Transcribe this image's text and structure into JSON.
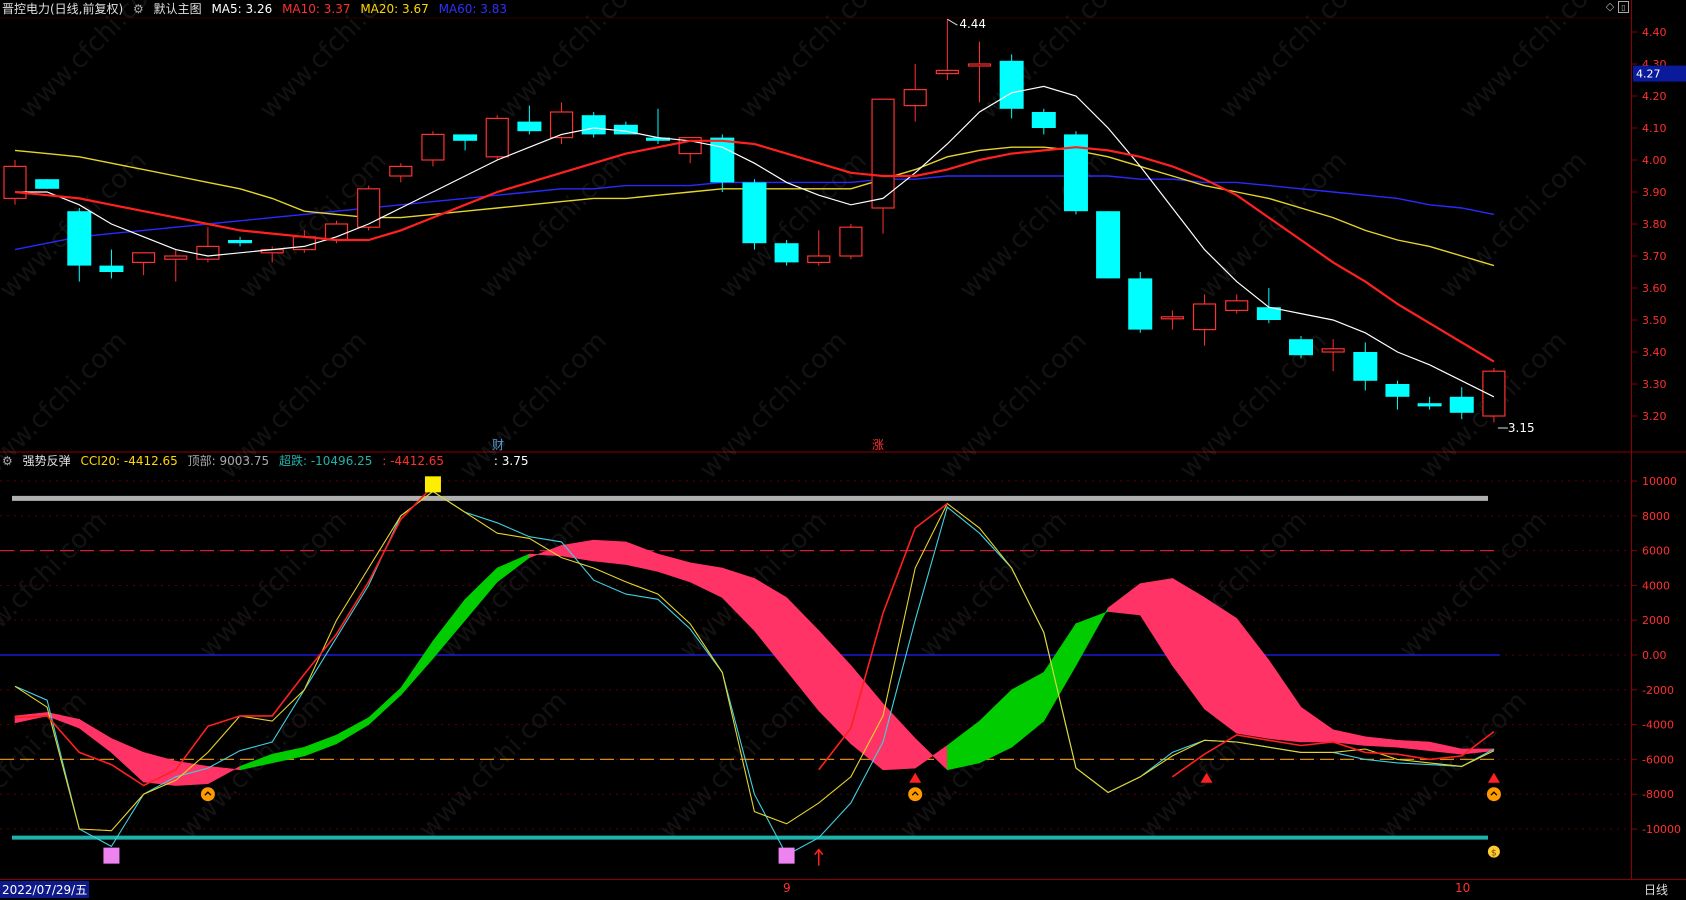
{
  "top_panel": {
    "title": "晋控电力(日线,前复权)",
    "main_chart_label": "默认主图",
    "ma_labels": [
      {
        "text": "MA5: 3.26",
        "color": "#ffffff"
      },
      {
        "text": "MA10: 3.37",
        "color": "#ff3030"
      },
      {
        "text": "MA20: 3.67",
        "color": "#ffd700"
      },
      {
        "text": "MA60: 3.83",
        "color": "#3030ff"
      }
    ],
    "current_price_tag": "4.27",
    "high_label": "4.44",
    "low_label": "3.15",
    "markers": [
      {
        "text": "财",
        "color": "#5a9bd5"
      },
      {
        "text": "涨",
        "color": "#ff3030"
      }
    ]
  },
  "bottom_panel": {
    "indicator_name": "强势反弹",
    "cci_label": "CCI20: -4412.65",
    "top_label": "顶部: 9003.75",
    "oversold_label": "超跌: -10496.25",
    "extra_label": ": -4412.65",
    "extra_label2": ": 3.75"
  },
  "bottom_bar": {
    "date": "2022/07/29/五",
    "period": "日线",
    "tick_9": "9",
    "tick_10": "10"
  },
  "watermark": "www.cfchi.com",
  "colors": {
    "up": "#ff3030",
    "down": "#00ffff",
    "ma5": "#ffffff",
    "ma10": "#ff2020",
    "ma20": "#e6d42a",
    "ma60": "#2a2aff",
    "pink": "#ff3366",
    "green": "#00cc00"
  },
  "chart_data": [
    {
      "type": "candlestick",
      "title": "晋控电力(日线,前复权)",
      "ylim": [
        3.15,
        4.44
      ],
      "yticks": [
        "4.40",
        "4.30",
        "4.20",
        "4.10",
        "4.00",
        "3.90",
        "3.80",
        "3.70",
        "3.60",
        "3.50",
        "3.40",
        "3.30",
        "3.20"
      ],
      "candles": [
        {
          "o": 3.88,
          "h": 4.0,
          "l": 3.86,
          "c": 3.98
        },
        {
          "o": 3.94,
          "h": 3.94,
          "l": 3.91,
          "c": 3.91
        },
        {
          "o": 3.84,
          "h": 3.85,
          "l": 3.62,
          "c": 3.67
        },
        {
          "o": 3.67,
          "h": 3.72,
          "l": 3.63,
          "c": 3.65
        },
        {
          "o": 3.68,
          "h": 3.71,
          "l": 3.64,
          "c": 3.71
        },
        {
          "o": 3.69,
          "h": 3.72,
          "l": 3.62,
          "c": 3.7
        },
        {
          "o": 3.69,
          "h": 3.79,
          "l": 3.68,
          "c": 3.73
        },
        {
          "o": 3.75,
          "h": 3.76,
          "l": 3.73,
          "c": 3.74
        },
        {
          "o": 3.71,
          "h": 3.73,
          "l": 3.68,
          "c": 3.72
        },
        {
          "o": 3.72,
          "h": 3.78,
          "l": 3.71,
          "c": 3.76
        },
        {
          "o": 3.75,
          "h": 3.81,
          "l": 3.74,
          "c": 3.8
        },
        {
          "o": 3.79,
          "h": 3.92,
          "l": 3.78,
          "c": 3.91
        },
        {
          "o": 3.95,
          "h": 3.99,
          "l": 3.93,
          "c": 3.98
        },
        {
          "o": 4.0,
          "h": 4.09,
          "l": 3.98,
          "c": 4.08
        },
        {
          "o": 4.08,
          "h": 4.08,
          "l": 4.03,
          "c": 4.06
        },
        {
          "o": 4.01,
          "h": 4.14,
          "l": 4.0,
          "c": 4.13
        },
        {
          "o": 4.12,
          "h": 4.17,
          "l": 4.08,
          "c": 4.09
        },
        {
          "o": 4.07,
          "h": 4.18,
          "l": 4.05,
          "c": 4.15
        },
        {
          "o": 4.14,
          "h": 4.15,
          "l": 4.07,
          "c": 4.08
        },
        {
          "o": 4.11,
          "h": 4.12,
          "l": 4.08,
          "c": 4.08
        },
        {
          "o": 4.07,
          "h": 4.16,
          "l": 4.05,
          "c": 4.06
        },
        {
          "o": 4.02,
          "h": 4.07,
          "l": 3.99,
          "c": 4.07
        },
        {
          "o": 4.07,
          "h": 4.08,
          "l": 3.9,
          "c": 3.93
        },
        {
          "o": 3.93,
          "h": 3.94,
          "l": 3.72,
          "c": 3.74
        },
        {
          "o": 3.74,
          "h": 3.75,
          "l": 3.67,
          "c": 3.68
        },
        {
          "o": 3.68,
          "h": 3.78,
          "l": 3.67,
          "c": 3.7
        },
        {
          "o": 3.7,
          "h": 3.8,
          "l": 3.69,
          "c": 3.79
        },
        {
          "o": 3.85,
          "h": 4.19,
          "l": 3.77,
          "c": 4.19
        },
        {
          "o": 4.17,
          "h": 4.3,
          "l": 4.12,
          "c": 4.22
        },
        {
          "o": 4.27,
          "h": 4.44,
          "l": 4.25,
          "c": 4.28
        },
        {
          "o": 4.3,
          "h": 4.37,
          "l": 4.18,
          "c": 4.3
        },
        {
          "o": 4.31,
          "h": 4.33,
          "l": 4.13,
          "c": 4.16
        },
        {
          "o": 4.15,
          "h": 4.16,
          "l": 4.08,
          "c": 4.1
        },
        {
          "o": 4.08,
          "h": 4.09,
          "l": 3.83,
          "c": 3.84
        },
        {
          "o": 3.84,
          "h": 3.84,
          "l": 3.63,
          "c": 3.63
        },
        {
          "o": 3.63,
          "h": 3.65,
          "l": 3.46,
          "c": 3.47
        },
        {
          "o": 3.51,
          "h": 3.53,
          "l": 3.47,
          "c": 3.51
        },
        {
          "o": 3.47,
          "h": 3.58,
          "l": 3.42,
          "c": 3.55
        },
        {
          "o": 3.53,
          "h": 3.58,
          "l": 3.52,
          "c": 3.56
        },
        {
          "o": 3.54,
          "h": 3.6,
          "l": 3.49,
          "c": 3.5
        },
        {
          "o": 3.44,
          "h": 3.45,
          "l": 3.38,
          "c": 3.39
        },
        {
          "o": 3.4,
          "h": 3.44,
          "l": 3.34,
          "c": 3.41
        },
        {
          "o": 3.4,
          "h": 3.43,
          "l": 3.28,
          "c": 3.31
        },
        {
          "o": 3.3,
          "h": 3.31,
          "l": 3.22,
          "c": 3.26
        },
        {
          "o": 3.24,
          "h": 3.26,
          "l": 3.22,
          "c": 3.23
        },
        {
          "o": 3.26,
          "h": 3.29,
          "l": 3.19,
          "c": 3.21
        },
        {
          "o": 3.2,
          "h": 3.35,
          "l": 3.18,
          "c": 3.34
        }
      ],
      "ma5": [
        3.9,
        3.9,
        3.86,
        3.8,
        3.76,
        3.72,
        3.7,
        3.71,
        3.72,
        3.73,
        3.76,
        3.8,
        3.85,
        3.9,
        3.95,
        4.0,
        4.04,
        4.08,
        4.1,
        4.09,
        4.07,
        4.06,
        4.04,
        3.99,
        3.93,
        3.89,
        3.86,
        3.88,
        3.96,
        4.05,
        4.15,
        4.21,
        4.23,
        4.2,
        4.1,
        3.98,
        3.85,
        3.72,
        3.62,
        3.54,
        3.52,
        3.5,
        3.46,
        3.4,
        3.36,
        3.31,
        3.26
      ],
      "ma10": [
        3.9,
        3.89,
        3.88,
        3.86,
        3.84,
        3.82,
        3.8,
        3.78,
        3.77,
        3.76,
        3.75,
        3.75,
        3.78,
        3.82,
        3.86,
        3.9,
        3.93,
        3.96,
        3.99,
        4.02,
        4.04,
        4.06,
        4.06,
        4.05,
        4.02,
        3.99,
        3.96,
        3.95,
        3.95,
        3.97,
        4.0,
        4.02,
        4.03,
        4.04,
        4.03,
        4.01,
        3.98,
        3.94,
        3.89,
        3.82,
        3.75,
        3.68,
        3.62,
        3.55,
        3.49,
        3.43,
        3.37
      ],
      "ma20": [
        4.03,
        4.02,
        4.01,
        3.99,
        3.97,
        3.95,
        3.93,
        3.91,
        3.88,
        3.84,
        3.83,
        3.82,
        3.82,
        3.83,
        3.84,
        3.85,
        3.86,
        3.87,
        3.88,
        3.88,
        3.89,
        3.9,
        3.91,
        3.91,
        3.91,
        3.91,
        3.91,
        3.94,
        3.97,
        4.01,
        4.03,
        4.04,
        4.04,
        4.03,
        4.01,
        3.98,
        3.95,
        3.92,
        3.9,
        3.88,
        3.85,
        3.82,
        3.78,
        3.75,
        3.73,
        3.7,
        3.67
      ],
      "ma60": [
        3.72,
        3.74,
        3.76,
        3.77,
        3.78,
        3.79,
        3.8,
        3.81,
        3.82,
        3.83,
        3.84,
        3.85,
        3.86,
        3.87,
        3.88,
        3.89,
        3.9,
        3.91,
        3.91,
        3.92,
        3.92,
        3.92,
        3.93,
        3.93,
        3.93,
        3.93,
        3.93,
        3.94,
        3.94,
        3.95,
        3.95,
        3.95,
        3.95,
        3.95,
        3.95,
        3.94,
        3.94,
        3.93,
        3.93,
        3.92,
        3.91,
        3.9,
        3.89,
        3.88,
        3.86,
        3.85,
        3.83
      ]
    },
    {
      "type": "line",
      "title": "强势反弹",
      "ylim": [
        -11500,
        11000
      ],
      "yticks": [
        "10000",
        "8000",
        "6000",
        "4000",
        "2000",
        "0.00",
        "-2000",
        "-4000",
        "-6000",
        "-8000",
        "-10000"
      ],
      "ref_lines": {
        "top": 9003.75,
        "oversold": -10496.25,
        "dash_red": 6000,
        "zero": 0,
        "dash_orange": -6000
      },
      "cci_red": [
        -3600,
        -3500,
        -5600,
        -6300,
        -7500,
        -6600,
        -4100,
        -3500,
        -3500,
        -1100,
        1200,
        4200,
        7800,
        9700,
        null,
        null,
        null,
        null,
        null,
        null,
        null,
        null,
        null,
        null,
        null,
        -6600,
        -4200,
        2400,
        7300,
        8700,
        null,
        null,
        null,
        null,
        null,
        null,
        -7000,
        -5700,
        -4600,
        -4900,
        -5200,
        -5000,
        -5600,
        -5700,
        -6000,
        -5800,
        -4400
      ],
      "cci_yellow": [
        -1800,
        -3000,
        -10000,
        -10100,
        -8000,
        -7200,
        -5600,
        -3500,
        -3800,
        -2000,
        2000,
        5000,
        8000,
        9400,
        8200,
        7000,
        6700,
        5600,
        5000,
        4200,
        3500,
        1800,
        -1000,
        -9000,
        -9700,
        -8500,
        -7000,
        -3500,
        5000,
        8700,
        7300,
        5000,
        1300,
        -6500,
        -7900,
        -7000,
        -5800,
        -4900,
        -5000,
        -5300,
        -5600,
        -5600,
        -5400,
        -6000,
        -6200,
        -6400,
        -5500
      ],
      "cci_cyan": [
        -1800,
        -2600,
        -10000,
        -11000,
        -8000,
        -7000,
        -6500,
        -5500,
        -5000,
        -2000,
        1000,
        4000,
        8000,
        9400,
        8200,
        7600,
        6800,
        6500,
        4300,
        3500,
        3200,
        1500,
        -1000,
        -8000,
        -11500,
        -10500,
        -8500,
        -5000,
        2000,
        8500,
        7000,
        5000,
        1300,
        -6500,
        -7900,
        -7000,
        -5600,
        -4900,
        -5000,
        -5300,
        -5600,
        -5600,
        -6000,
        -6200,
        -6300,
        -6400,
        -5400
      ],
      "band_a": [
        -3500,
        -3300,
        -3700,
        -4800,
        -5600,
        -6100,
        -6400,
        -6600,
        -6200,
        -5800,
        -5100,
        -4000,
        -2300,
        -200,
        2000,
        4200,
        5600,
        6300,
        6600,
        6500,
        5800,
        5300,
        5000,
        4400,
        3300,
        1400,
        -600,
        -2800,
        -4800,
        -6600,
        -6200,
        -5300,
        -3800,
        -600,
        2700,
        4100,
        4400,
        3300,
        2100,
        -300,
        -3000,
        -4300,
        -4700,
        -4900,
        -5000,
        -5400,
        -5400
      ],
      "band_b": [
        -3900,
        -3500,
        -4200,
        -5600,
        -7300,
        -7500,
        -7400,
        -6400,
        -5700,
        -5300,
        -4600,
        -3600,
        -1900,
        800,
        3200,
        5000,
        5800,
        5700,
        5400,
        5200,
        4800,
        4200,
        3300,
        1400,
        -900,
        -3200,
        -5100,
        -6600,
        -6500,
        -5200,
        -3800,
        -2000,
        -1000,
        1800,
        2500,
        2300,
        -600,
        -3100,
        -4500,
        -4800,
        -5000,
        -5000,
        -5200,
        -5300,
        -5500,
        -5700,
        -5500
      ],
      "signals": {
        "yellow_square_index": 13,
        "pink_square_indices": [
          3,
          24
        ],
        "up_arrow_indices": [
          28,
          37,
          46
        ],
        "red_small_arrow_index": 25,
        "smile_indices": [
          6,
          28,
          46
        ]
      }
    }
  ]
}
